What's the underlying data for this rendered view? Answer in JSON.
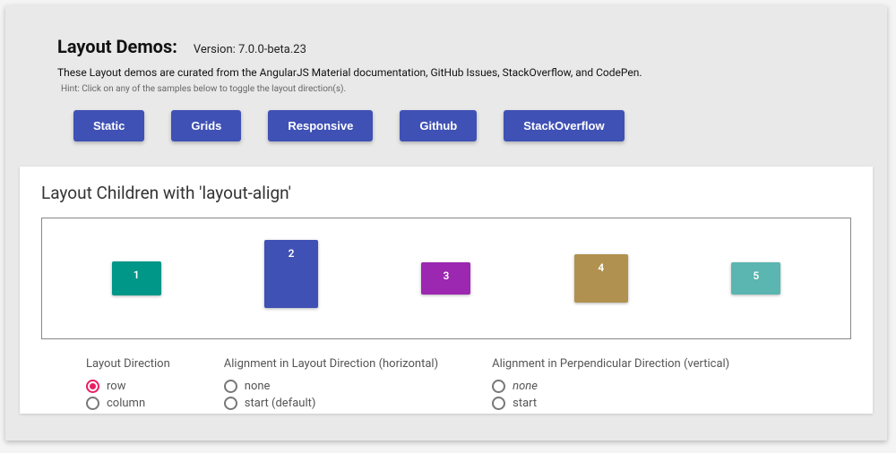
{
  "header": {
    "title": "Layout Demos:",
    "version": "Version: 7.0.0-beta.23",
    "subtitle": "These Layout demos are curated from the AngularJS Material documentation, GitHub Issues, StackOverflow, and CodePen.",
    "hint": "Hint: Click on any of the samples below to toggle the layout direction(s)."
  },
  "nav_buttons": {
    "static": "Static",
    "grids": "Grids",
    "responsive": "Responsive",
    "github": "Github",
    "stackoverflow": "StackOverflow"
  },
  "demo": {
    "title": "Layout Children with 'layout-align'",
    "blocks": {
      "b1": "1",
      "b2": "2",
      "b3": "3",
      "b4": "4",
      "b5": "5"
    }
  },
  "controls": {
    "direction": {
      "title": "Layout Direction",
      "opts": {
        "row": "row",
        "column": "column"
      },
      "selected": "row"
    },
    "main_axis": {
      "title": "Alignment in Layout Direction (horizontal)",
      "opts": {
        "none": "none",
        "start": "start (default)"
      }
    },
    "cross_axis": {
      "title": "Alignment in Perpendicular Direction (vertical)",
      "opts": {
        "none": "none",
        "start": "start"
      }
    }
  }
}
